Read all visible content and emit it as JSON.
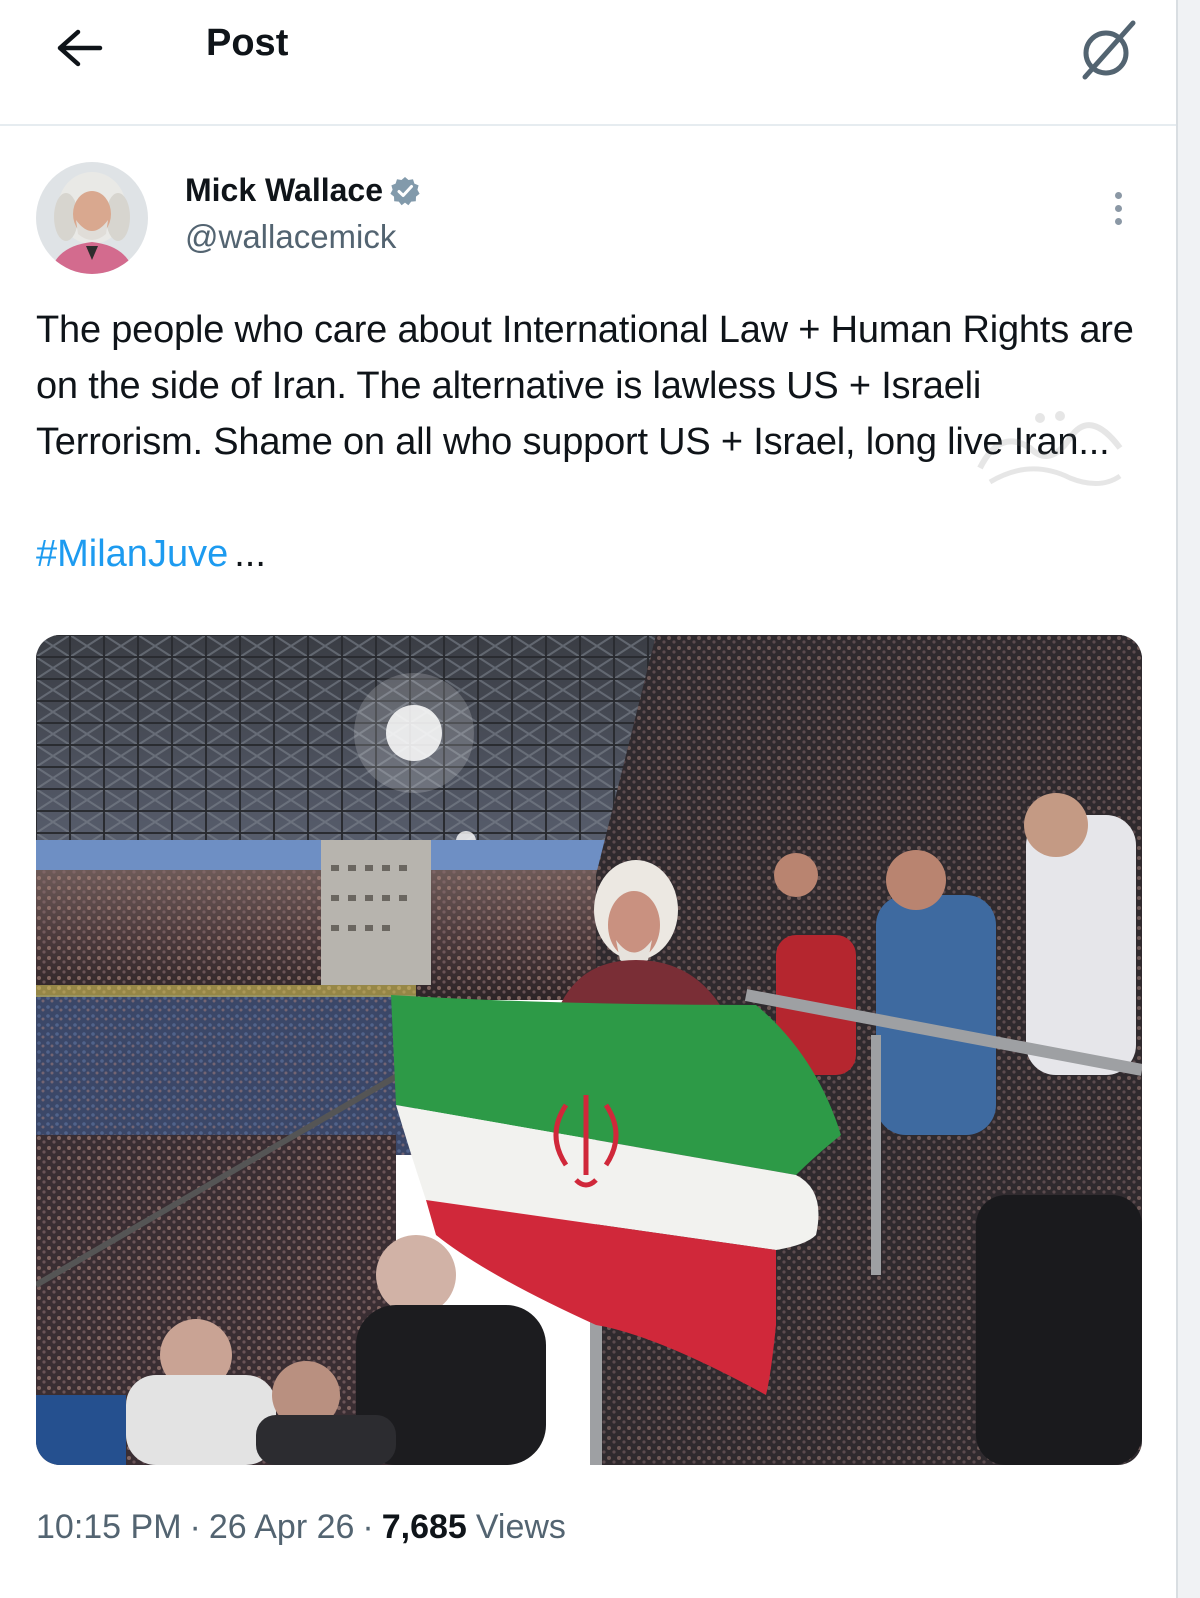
{
  "header": {
    "title": "Post",
    "back_icon": "arrow-left-icon",
    "grok_icon": "grok-icon"
  },
  "author": {
    "display_name": "Mick Wallace",
    "handle": "@wallacemick",
    "verified": true,
    "avatar_icon": "avatar-photo"
  },
  "post": {
    "text": "The people who care about International Law + Human Rights are on the side of Iran. The alternative is lawless US + Israeli Terrorism. Shame on all who support US + Israel, long live Iran...",
    "hashtag": "#MilanJuve",
    "truncation": "...",
    "media_description_icon": "stadium-photo-with-iranian-flag"
  },
  "meta": {
    "time": "10:15 PM",
    "date": "26 Apr 26",
    "views_count": "7,685",
    "views_label": "Views",
    "separator": "·"
  },
  "colors": {
    "text_primary": "#0f1419",
    "text_secondary": "#536471",
    "link": "#1d9bf0",
    "verified_badge": "#829aab"
  }
}
